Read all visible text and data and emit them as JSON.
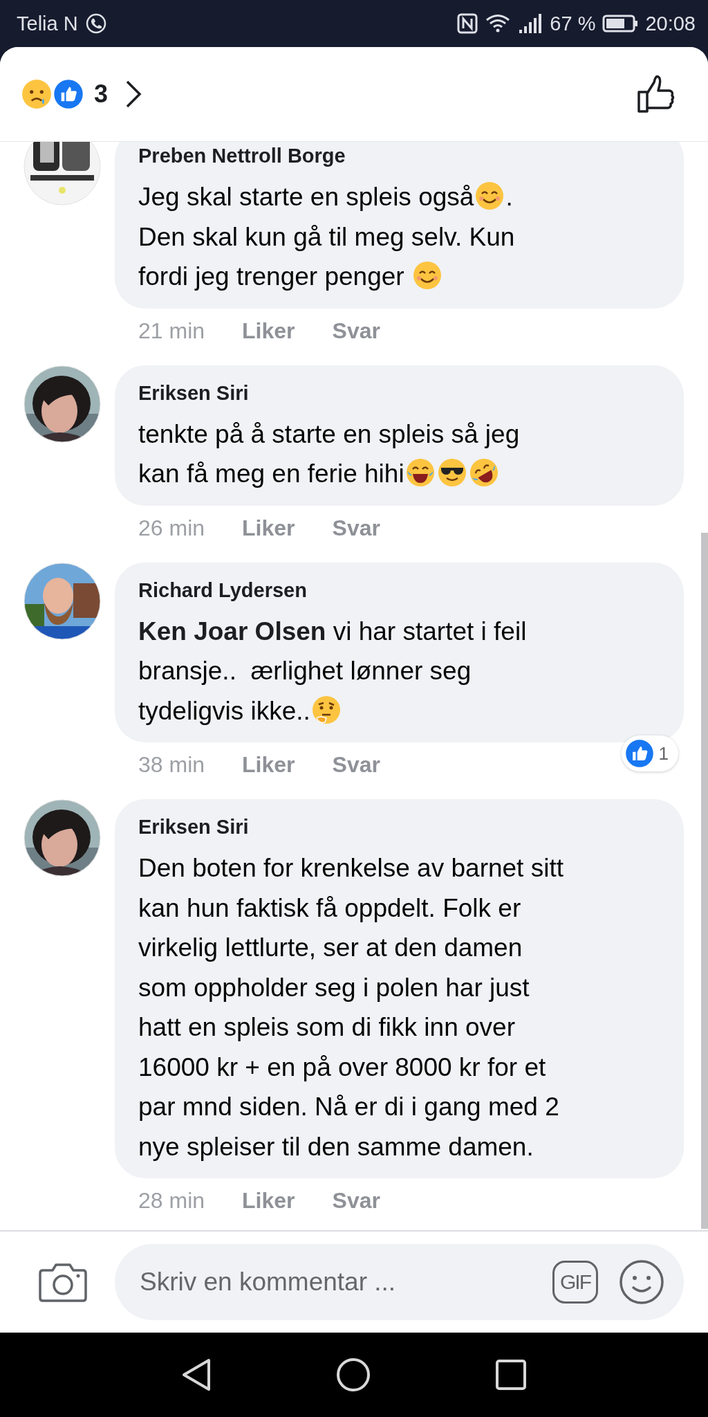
{
  "status_bar": {
    "carrier": "Telia N",
    "battery": "67 %",
    "time": "20:08"
  },
  "reactions_header": {
    "count": "3"
  },
  "comments": [
    {
      "author": "Preben Nettroll Borge",
      "lines": [
        [
          {
            "kind": "text",
            "text": "Jeg skal starte en spleis også"
          },
          {
            "kind": "smile"
          },
          {
            "kind": "text",
            "text": "."
          }
        ],
        [
          {
            "kind": "text",
            "text": "Den skal kun gå til meg selv. Kun"
          }
        ],
        [
          {
            "kind": "text",
            "text": "fordi jeg trenger penger "
          },
          {
            "kind": "smile"
          }
        ]
      ],
      "time": "21 min",
      "actions": [
        "Liker",
        "Svar"
      ]
    },
    {
      "author": "Eriksen Siri",
      "lines": [
        [
          {
            "kind": "text",
            "text": "tenkte på å starte en spleis så jeg"
          }
        ],
        [
          {
            "kind": "text",
            "text": "kan få meg en ferie hihi"
          },
          {
            "kind": "joy"
          },
          {
            "kind": "cool"
          },
          {
            "kind": "rofl"
          }
        ]
      ],
      "time": "26 min",
      "actions": [
        "Liker",
        "Svar"
      ]
    },
    {
      "author": "Richard Lydersen",
      "lines": [
        [
          {
            "kind": "mention",
            "text": "Ken Joar Olsen"
          },
          {
            "kind": "text",
            "text": " vi har startet i feil"
          }
        ],
        [
          {
            "kind": "text",
            "text": "bransje..  ærlighet lønner seg"
          }
        ],
        [
          {
            "kind": "text",
            "text": "tydeligvis ikke.."
          },
          {
            "kind": "thinking"
          }
        ]
      ],
      "time": "38 min",
      "actions": [
        "Liker",
        "Svar"
      ],
      "reaction_count": "1"
    },
    {
      "author": "Eriksen Siri",
      "lines": [
        [
          {
            "kind": "text",
            "text": "Den boten for krenkelse av barnet sitt"
          }
        ],
        [
          {
            "kind": "text",
            "text": "kan hun faktisk få oppdelt. Folk er"
          }
        ],
        [
          {
            "kind": "text",
            "text": "virkelig lettlurte, ser at den damen"
          }
        ],
        [
          {
            "kind": "text",
            "text": "som oppholder seg i polen har just"
          }
        ],
        [
          {
            "kind": "text",
            "text": "hatt en spleis som di fikk inn over"
          }
        ],
        [
          {
            "kind": "text",
            "text": "16000 kr + en på over 8000 kr for et"
          }
        ],
        [
          {
            "kind": "text",
            "text": "par mnd siden. Nå er di i gang med 2"
          }
        ],
        [
          {
            "kind": "text",
            "text": "nye spleiser til den samme damen."
          }
        ]
      ],
      "time": "28 min",
      "actions": [
        "Liker",
        "Svar"
      ]
    }
  ],
  "composer": {
    "placeholder": "Skriv en kommentar ...",
    "gif": "GIF"
  }
}
